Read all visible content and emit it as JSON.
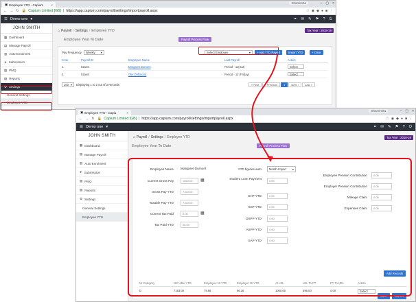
{
  "w1": {
    "tab_title": "Employee YTD - Capium",
    "user_chip": "Shamim/ta",
    "url_host": "Capium Limited [GB]",
    "url_path": "https://app.capium.com/payroll/settings/importpayroll.aspx",
    "company": "Demo one",
    "user_name": "JOHN SMITH",
    "tax_year": "Tax Year : 2018-19",
    "crumb": {
      "home": "Payroll",
      "settings": "Settings",
      "current": "Employee YTD"
    },
    "page_title": "Employee Year To Date",
    "flow_btn": "Payroll Process Flow",
    "pay_freq_label": "Pay Frequency",
    "pay_freq_value": "Weekly",
    "select_employee": "Select Employee",
    "btn_add": "+ Add YTD Payroll",
    "btn_import": "Import YTD",
    "btn_clear": "+ Clear",
    "table": {
      "headers": [
        "S.No",
        "Payroll ID",
        "Employee Name",
        "",
        "Last Payroll",
        "Action"
      ],
      "rows": [
        {
          "sno": "1.",
          "pid": "02ae6",
          "name": "Margaret Dumont",
          "last": "Period - 11(Sat)",
          "action": "Select"
        },
        {
          "sno": "2.",
          "pid": "02ae8",
          "name": "Otis Driftwood",
          "last": "Period - 12 (Friday)",
          "action": "Select"
        }
      ]
    },
    "page_size": "100",
    "records_text": "Displaying 1 to 2 out of 2 Records",
    "pager": [
      "« First",
      "‹ Previous",
      "1",
      "Next ›",
      "Last »"
    ],
    "sidebar": [
      {
        "label": "Dashboard",
        "icon": "dashboard-icon"
      },
      {
        "label": "Manage Payroll",
        "icon": "payroll-icon"
      },
      {
        "label": "Auto Enrolment",
        "icon": "enrolment-icon"
      },
      {
        "label": "Submission",
        "icon": "submission-icon"
      },
      {
        "label": "PMQ",
        "icon": "pmq-icon"
      },
      {
        "label": "Reports",
        "icon": "reports-icon"
      },
      {
        "label": "Settings",
        "icon": "settings-icon"
      }
    ],
    "sub": [
      "General Settings",
      "Employee YTD"
    ]
  },
  "w2": {
    "tab_title": "Employee YTD - Capiu",
    "user_chip": "Shamim/ta",
    "url_host": "Capium Limited [GB]",
    "url_path": "https://app.capium.com/payroll/settings/importpayroll.aspx",
    "company": "Demo one",
    "user_name": "JOHN SMITH",
    "tax_year": "Tax Year : 2018-19",
    "crumb": {
      "home": "Payroll",
      "settings": "Settings",
      "current": "Employee YTD"
    },
    "page_title": "Employee Year To Date",
    "flow_btn": "Payroll Process Flow",
    "sidebar": [
      {
        "label": "Dashboard",
        "icon": "dashboard-icon"
      },
      {
        "label": "Manage Payroll",
        "icon": "payroll-icon"
      },
      {
        "label": "Auto Enrolment",
        "icon": "enrolment-icon"
      },
      {
        "label": "Submission",
        "icon": "submission-icon"
      },
      {
        "label": "PMQ",
        "icon": "pmq-icon"
      },
      {
        "label": "Reports",
        "icon": "reports-icon"
      },
      {
        "label": "Settings",
        "icon": "settings-icon"
      }
    ],
    "sub": [
      "General Settings",
      "Employee YTD"
    ],
    "form": {
      "employee_name_label": "Employee Name",
      "employee_name_value": "Margaret Dumont",
      "ytd_auto_label": "YTD figures auto",
      "ytd_auto_value": "Month-Import",
      "current_gross_label": "Current Gross Pay",
      "current_gross_value": "1563.00",
      "gross_ytd_label": "Gross Pay YTD",
      "gross_ytd_value": "7163.00",
      "taxable_ytd_label": "Taxable Pay YTD",
      "taxable_ytd_value": "7163.00",
      "current_tax_label": "Current Tax Paid",
      "current_tax_value": "0.00",
      "tax_ytd_label": "Tax Paid YTD",
      "tax_ytd_value": "56.00",
      "student_loan_label": "Student Loan Payment",
      "student_loan_value": "0.00",
      "shp_label": "SHP YTD",
      "shp_value": "0.00",
      "ssp_label": "SSP YTD",
      "ssp_value": "0.00",
      "ospp_label": "OSPP YTD",
      "ospp_value": "0.00",
      "aspp_label": "ASPP YTD",
      "aspp_value": "0.00",
      "sap_label": "SAP YTD",
      "sap_value": "0.00",
      "emp_pension_label": "Employee Pension Contribution",
      "emp_pension_value": "0.00",
      "er_pension_label": "Employer Pension Contribution",
      "er_pension_value": "0.00",
      "mileage_label": "Mileage Claim",
      "mileage_value": "0.00",
      "expenses_label": "Expenses Claim",
      "expenses_value": "0.00",
      "add_records": "Add Records",
      "ni_headers": [
        "NI Category",
        "NIC able YTD",
        "Employee NI YTD",
        "Employer NI YTD",
        "At LEL",
        "LEL To PT",
        "PT To UEL",
        "Action"
      ],
      "ni_row": [
        "D",
        "7163.00",
        "79.66",
        "96.36",
        "1000.00",
        "596.00",
        "0.00",
        "Select"
      ],
      "save": "Save",
      "cancel": "Cancel"
    }
  }
}
